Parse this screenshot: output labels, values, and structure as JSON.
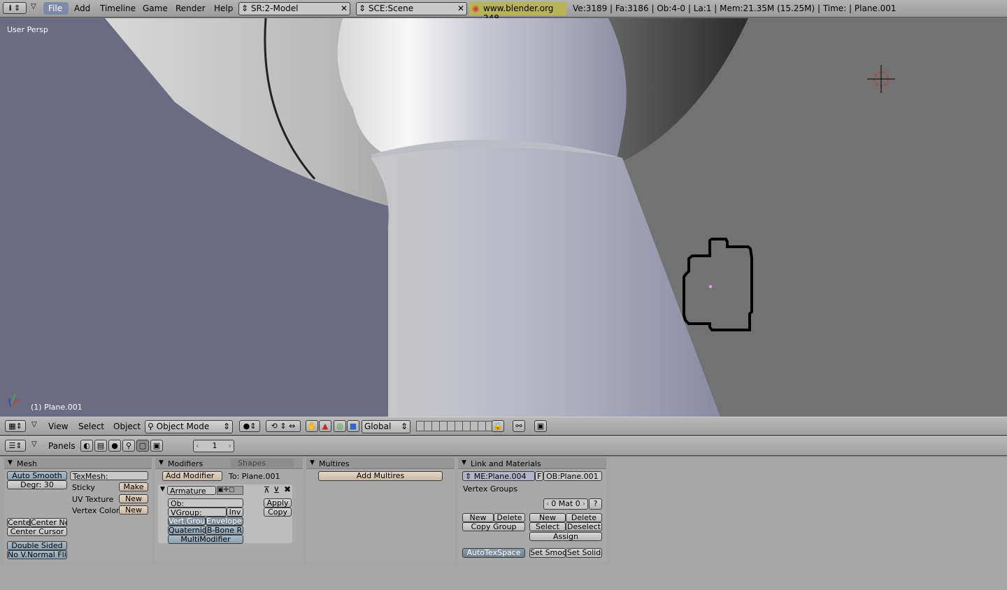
{
  "topbar": {
    "info_icon": "i",
    "menus": [
      "File",
      "Add",
      "Timeline",
      "Game",
      "Render",
      "Help"
    ],
    "screen": "SR:2-Model",
    "scene": "SCE:Scene",
    "blender_link": "www.blender.org 248",
    "stats": "Ve:3189 | Fa:3186 | Ob:4-0 | La:1  | Mem:21.35M (15.25M)  | Time: | Plane.001"
  },
  "viewport": {
    "view_label": "User Persp",
    "object_label": "(1) Plane.001",
    "colors": {
      "left_bg": "#6a6a82",
      "right_bg": "#727272"
    }
  },
  "view3d_header": {
    "menus": [
      "View",
      "Select",
      "Object"
    ],
    "mode": "Object Mode",
    "orientation": "Global"
  },
  "buttons_header": {
    "panels_label": "Panels",
    "frame": "1"
  },
  "mesh_panel": {
    "title": "Mesh",
    "auto_smooth": "Auto Smooth",
    "degr": "Degr: 30",
    "texmesh": "TexMesh:",
    "sticky": "Sticky",
    "sticky_btn": "Make",
    "uv_texture": "UV Texture",
    "uv_btn": "New",
    "vertex_color": "Vertex Color",
    "vc_btn": "New",
    "cente": "Cente",
    "center_new": "Center Ne",
    "center_cursor": "Center Cursor",
    "double_sided": "Double Sided",
    "no_vnormal": "No V.Normal Flip"
  },
  "modifiers_panel": {
    "tab1": "Modifiers",
    "tab2": "Shapes",
    "add_modifier": "Add Modifier",
    "to": "To: Plane.001",
    "armature": "Armature",
    "ob": "Ob:",
    "vgroup": "VGroup:",
    "inv": "Inv",
    "vert_grou": "Vert.Grou",
    "envelopes": "Envelopes",
    "quaternio": "Quaternio",
    "bbone": "B-Bone R",
    "multimodifier": "MultiModifier",
    "apply": "Apply",
    "copy": "Copy"
  },
  "multires_panel": {
    "title": "Multires",
    "add_multires": "Add Multires"
  },
  "link_panel": {
    "title": "Link and Materials",
    "me": "ME:Plane.004",
    "f": "F",
    "ob": "OB:Plane.001",
    "vertex_groups": "Vertex Groups",
    "mat": "0 Mat 0",
    "q": "?",
    "new1": "New",
    "delete1": "Delete",
    "copy_group": "Copy Group",
    "new2": "New",
    "delete2": "Delete",
    "select": "Select",
    "deselect": "Deselect",
    "assign": "Assign",
    "autotexspace": "AutoTexSpace",
    "set_smoo": "Set Smoo",
    "set_solid": "Set Solid"
  }
}
